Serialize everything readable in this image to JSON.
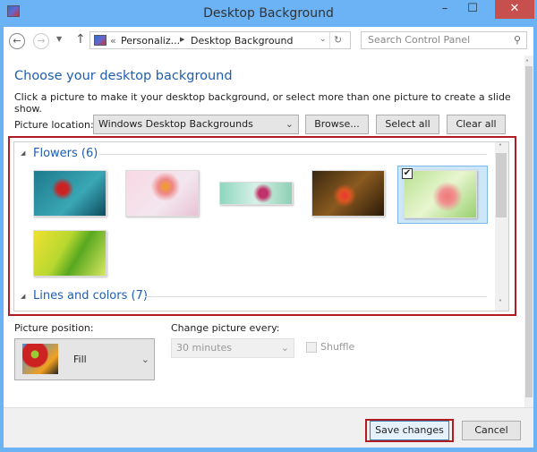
{
  "window": {
    "title": "Desktop Background",
    "minimize": "–",
    "maximize": "☐",
    "close": "✕"
  },
  "nav": {
    "back": "←",
    "forward": "→",
    "up": "↑",
    "breadcrumb": [
      "Personaliz...",
      "Desktop Background"
    ],
    "breadcrumb_prefix": "«",
    "refresh": "↻",
    "search_placeholder": "Search Control Panel"
  },
  "main": {
    "heading": "Choose your desktop background",
    "instructions": "Click a picture to make it your desktop background, or select more than one picture to create a slide show.",
    "location_label": "Picture location:",
    "location_value": "Windows Desktop Backgrounds",
    "browse": "Browse...",
    "select_all": "Select all",
    "clear_all": "Clear all",
    "groups": [
      {
        "label": "Flowers (6)",
        "selected_index": 4
      },
      {
        "label": "Lines and colors (7)"
      }
    ],
    "position_label": "Picture position:",
    "position_value": "Fill",
    "interval_label": "Change picture every:",
    "interval_value": "30 minutes",
    "shuffle_label": "Shuffle",
    "shuffle_checked": false
  },
  "footer": {
    "save": "Save changes",
    "cancel": "Cancel"
  },
  "colors": {
    "accent": "#1e5eb0",
    "highlight": "#b01c21",
    "titlebar": "#6bb3f5"
  }
}
